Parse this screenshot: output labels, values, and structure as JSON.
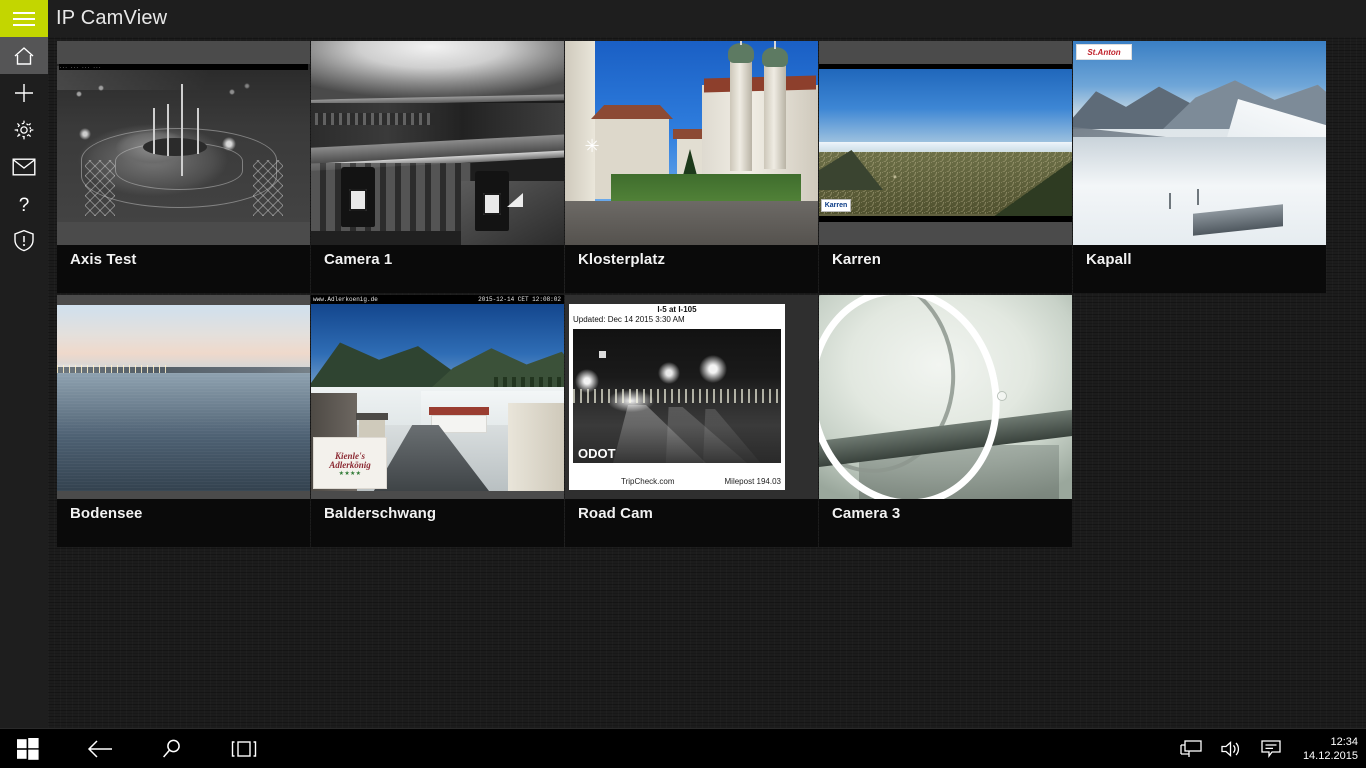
{
  "app": {
    "title": "IP CamView",
    "menu_icon": "hamburger-icon"
  },
  "sidebar": {
    "items": [
      {
        "name": "home",
        "icon": "home-icon",
        "active": true
      },
      {
        "name": "add",
        "icon": "plus-icon",
        "active": false
      },
      {
        "name": "settings",
        "icon": "gear-icon",
        "active": false
      },
      {
        "name": "mail",
        "icon": "mail-icon",
        "active": false
      },
      {
        "name": "help",
        "icon": "question-icon",
        "active": false
      },
      {
        "name": "security",
        "icon": "shield-alert-icon",
        "active": false
      }
    ]
  },
  "cameras": [
    {
      "label": "Axis Test",
      "overlay_top": "... ... ... ..."
    },
    {
      "label": "Camera 1",
      "overlay_top": ""
    },
    {
      "label": "Klosterplatz",
      "overlay_top": ""
    },
    {
      "label": "Karren",
      "overlay_top": "Karren",
      "logo": "Karren"
    },
    {
      "label": "Kapall",
      "overlay_top": "",
      "logo": "StAnton"
    },
    {
      "label": "Bodensee",
      "overlay_top": ""
    },
    {
      "label": "Balderschwang",
      "overlay_left": "www.Adlerkoenig.de",
      "overlay_right": "2015-12-14 CET 12:08:02",
      "logo_line1": "Kienle's",
      "logo_line2": "Adlerkönig",
      "logo_line3": "★★★★"
    },
    {
      "label": "Road Cam",
      "header_title": "I-5 at I-105",
      "header_updated": "Updated: Dec 14 2015  3:30 AM",
      "watermark": "ODOT",
      "footer_left": "TripCheck.com",
      "footer_right": "Milepost 194.03"
    },
    {
      "label": "Camera 3",
      "overlay_top": ""
    }
  ],
  "taskbar": {
    "start_icon": "windows-logo-icon",
    "back_icon": "back-arrow-icon",
    "search_icon": "search-icon",
    "taskview_icon": "task-view-icon",
    "network_icon": "network-icon",
    "volume_icon": "volume-icon",
    "action_center_icon": "action-center-icon",
    "time": "12:34",
    "date": "14.12.2015"
  },
  "colors": {
    "accent": "#c3d600",
    "app_background": "#1c1c1c",
    "tile_background": "#0a0a0a",
    "rail_background": "#1e1e1e",
    "rail_active": "#555556"
  }
}
